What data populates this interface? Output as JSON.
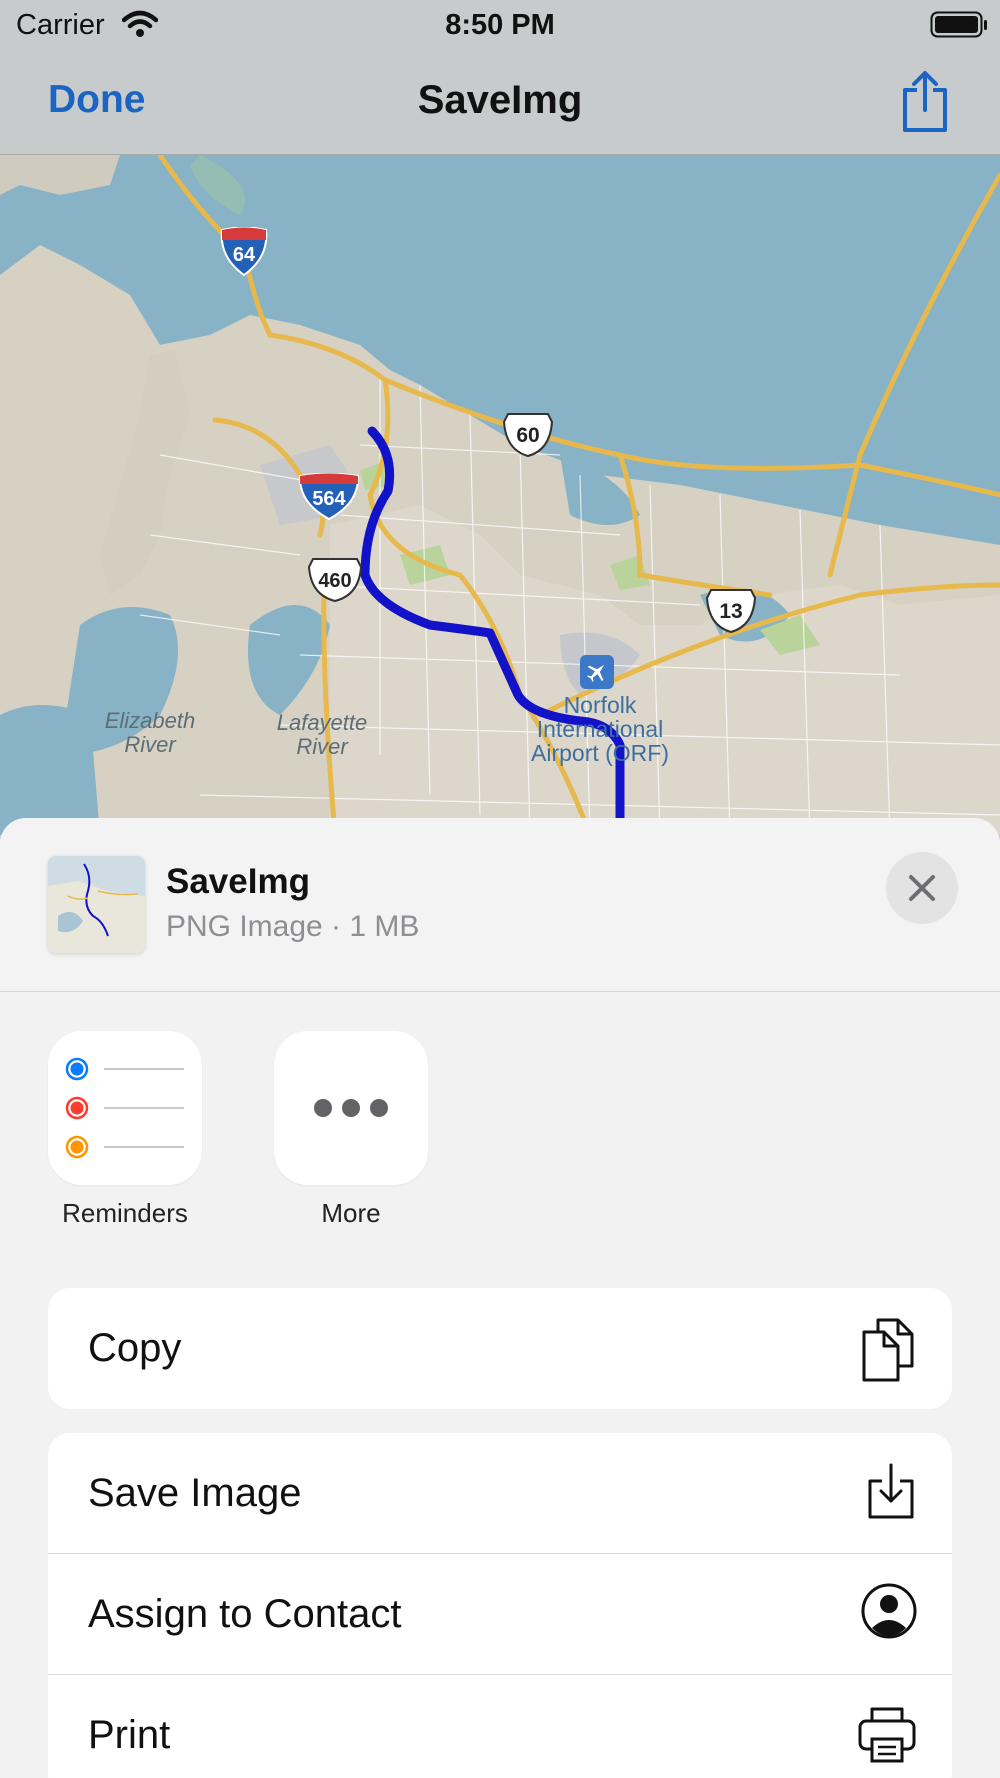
{
  "status_bar": {
    "carrier": "Carrier",
    "time": "8:50 PM"
  },
  "nav": {
    "done_label": "Done",
    "title": "SaveImg"
  },
  "map": {
    "shields": {
      "i64": "64",
      "i564": "564",
      "us60": "60",
      "us460": "460",
      "us13": "13"
    },
    "places": {
      "elizabeth_river": "Elizabeth\nRiver",
      "lafayette_river": "Lafayette\nRiver",
      "airport": "Norfolk\nInternational\nAirport (ORF)"
    }
  },
  "sheet": {
    "file_name": "SaveImg",
    "file_info": "PNG Image · 1 MB",
    "apps": [
      {
        "label": "Reminders",
        "icon": "reminders-icon"
      },
      {
        "label": "More",
        "icon": "more-icon"
      }
    ],
    "actions": {
      "copy": "Copy",
      "save_image": "Save Image",
      "assign_contact": "Assign to Contact",
      "print": "Print"
    }
  },
  "colors": {
    "accent": "#1a64c4",
    "route": "#1212c8",
    "water": "#88b2c5",
    "land": "#d9d4c6",
    "reminder_blue": "#0a7aff",
    "reminder_red": "#ff3b30",
    "reminder_orange": "#ff9500"
  }
}
